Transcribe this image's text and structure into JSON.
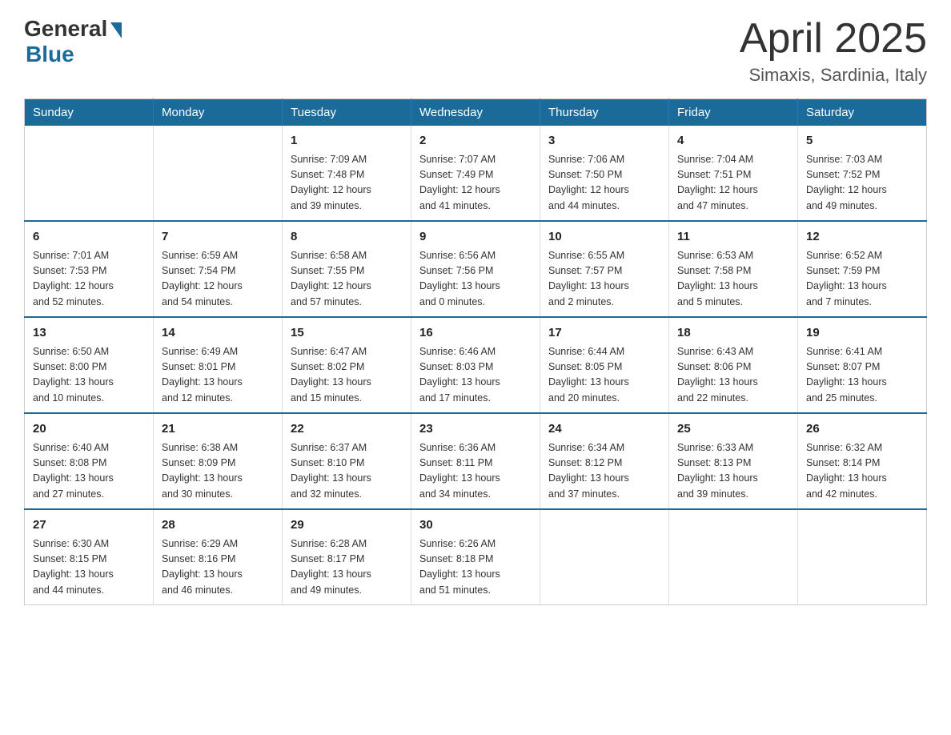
{
  "logo": {
    "general": "General",
    "blue": "Blue",
    "triangle_color": "#1a6b9a"
  },
  "header": {
    "month": "April 2025",
    "location": "Simaxis, Sardinia, Italy"
  },
  "weekdays": [
    "Sunday",
    "Monday",
    "Tuesday",
    "Wednesday",
    "Thursday",
    "Friday",
    "Saturday"
  ],
  "weeks": [
    [
      {
        "day": "",
        "info": ""
      },
      {
        "day": "",
        "info": ""
      },
      {
        "day": "1",
        "info": "Sunrise: 7:09 AM\nSunset: 7:48 PM\nDaylight: 12 hours\nand 39 minutes."
      },
      {
        "day": "2",
        "info": "Sunrise: 7:07 AM\nSunset: 7:49 PM\nDaylight: 12 hours\nand 41 minutes."
      },
      {
        "day": "3",
        "info": "Sunrise: 7:06 AM\nSunset: 7:50 PM\nDaylight: 12 hours\nand 44 minutes."
      },
      {
        "day": "4",
        "info": "Sunrise: 7:04 AM\nSunset: 7:51 PM\nDaylight: 12 hours\nand 47 minutes."
      },
      {
        "day": "5",
        "info": "Sunrise: 7:03 AM\nSunset: 7:52 PM\nDaylight: 12 hours\nand 49 minutes."
      }
    ],
    [
      {
        "day": "6",
        "info": "Sunrise: 7:01 AM\nSunset: 7:53 PM\nDaylight: 12 hours\nand 52 minutes."
      },
      {
        "day": "7",
        "info": "Sunrise: 6:59 AM\nSunset: 7:54 PM\nDaylight: 12 hours\nand 54 minutes."
      },
      {
        "day": "8",
        "info": "Sunrise: 6:58 AM\nSunset: 7:55 PM\nDaylight: 12 hours\nand 57 minutes."
      },
      {
        "day": "9",
        "info": "Sunrise: 6:56 AM\nSunset: 7:56 PM\nDaylight: 13 hours\nand 0 minutes."
      },
      {
        "day": "10",
        "info": "Sunrise: 6:55 AM\nSunset: 7:57 PM\nDaylight: 13 hours\nand 2 minutes."
      },
      {
        "day": "11",
        "info": "Sunrise: 6:53 AM\nSunset: 7:58 PM\nDaylight: 13 hours\nand 5 minutes."
      },
      {
        "day": "12",
        "info": "Sunrise: 6:52 AM\nSunset: 7:59 PM\nDaylight: 13 hours\nand 7 minutes."
      }
    ],
    [
      {
        "day": "13",
        "info": "Sunrise: 6:50 AM\nSunset: 8:00 PM\nDaylight: 13 hours\nand 10 minutes."
      },
      {
        "day": "14",
        "info": "Sunrise: 6:49 AM\nSunset: 8:01 PM\nDaylight: 13 hours\nand 12 minutes."
      },
      {
        "day": "15",
        "info": "Sunrise: 6:47 AM\nSunset: 8:02 PM\nDaylight: 13 hours\nand 15 minutes."
      },
      {
        "day": "16",
        "info": "Sunrise: 6:46 AM\nSunset: 8:03 PM\nDaylight: 13 hours\nand 17 minutes."
      },
      {
        "day": "17",
        "info": "Sunrise: 6:44 AM\nSunset: 8:05 PM\nDaylight: 13 hours\nand 20 minutes."
      },
      {
        "day": "18",
        "info": "Sunrise: 6:43 AM\nSunset: 8:06 PM\nDaylight: 13 hours\nand 22 minutes."
      },
      {
        "day": "19",
        "info": "Sunrise: 6:41 AM\nSunset: 8:07 PM\nDaylight: 13 hours\nand 25 minutes."
      }
    ],
    [
      {
        "day": "20",
        "info": "Sunrise: 6:40 AM\nSunset: 8:08 PM\nDaylight: 13 hours\nand 27 minutes."
      },
      {
        "day": "21",
        "info": "Sunrise: 6:38 AM\nSunset: 8:09 PM\nDaylight: 13 hours\nand 30 minutes."
      },
      {
        "day": "22",
        "info": "Sunrise: 6:37 AM\nSunset: 8:10 PM\nDaylight: 13 hours\nand 32 minutes."
      },
      {
        "day": "23",
        "info": "Sunrise: 6:36 AM\nSunset: 8:11 PM\nDaylight: 13 hours\nand 34 minutes."
      },
      {
        "day": "24",
        "info": "Sunrise: 6:34 AM\nSunset: 8:12 PM\nDaylight: 13 hours\nand 37 minutes."
      },
      {
        "day": "25",
        "info": "Sunrise: 6:33 AM\nSunset: 8:13 PM\nDaylight: 13 hours\nand 39 minutes."
      },
      {
        "day": "26",
        "info": "Sunrise: 6:32 AM\nSunset: 8:14 PM\nDaylight: 13 hours\nand 42 minutes."
      }
    ],
    [
      {
        "day": "27",
        "info": "Sunrise: 6:30 AM\nSunset: 8:15 PM\nDaylight: 13 hours\nand 44 minutes."
      },
      {
        "day": "28",
        "info": "Sunrise: 6:29 AM\nSunset: 8:16 PM\nDaylight: 13 hours\nand 46 minutes."
      },
      {
        "day": "29",
        "info": "Sunrise: 6:28 AM\nSunset: 8:17 PM\nDaylight: 13 hours\nand 49 minutes."
      },
      {
        "day": "30",
        "info": "Sunrise: 6:26 AM\nSunset: 8:18 PM\nDaylight: 13 hours\nand 51 minutes."
      },
      {
        "day": "",
        "info": ""
      },
      {
        "day": "",
        "info": ""
      },
      {
        "day": "",
        "info": ""
      }
    ]
  ]
}
